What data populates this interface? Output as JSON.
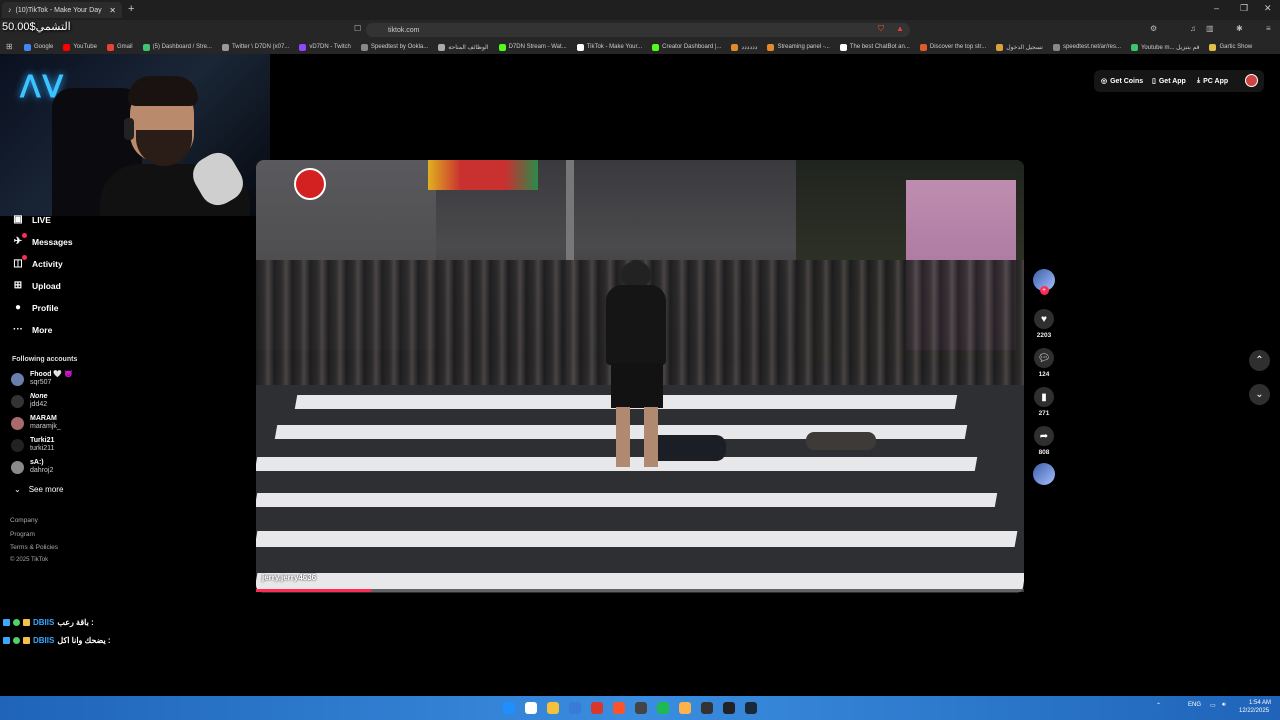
{
  "browser": {
    "tab_title": "(10)TikTok - Make Your Day",
    "tab_close": "✕",
    "new_tab": "+",
    "url": "tiktok.com",
    "window_controls": [
      "–",
      "❐",
      "✕"
    ],
    "bookmarks": [
      {
        "label": "Google",
        "color": "#4285f4"
      },
      {
        "label": "YouTube",
        "color": "#ff0000"
      },
      {
        "label": "Gmail",
        "color": "#ea4335"
      },
      {
        "label": "(5) Dashboard / Stre...",
        "color": "#3ec46d"
      },
      {
        "label": "Twitter \\ D7DN (x07...",
        "color": "#999999"
      },
      {
        "label": "vD7DN - Twitch",
        "color": "#9146ff"
      },
      {
        "label": "Speedtest by Ookla...",
        "color": "#888888"
      },
      {
        "label": "الوظائف المتاحة",
        "color": "#aaaaaa"
      },
      {
        "label": "D7DN Stream - Wat...",
        "color": "#53fc18"
      },
      {
        "label": "TikTok - Make Your...",
        "color": "#ffffff"
      },
      {
        "label": "Creator Dashboard |...",
        "color": "#53fc18"
      },
      {
        "label": "دددددد",
        "color": "#e08a2a"
      },
      {
        "label": "Streaming panel -...",
        "color": "#e08a2a"
      },
      {
        "label": "The best ChatBot an...",
        "color": "#ffffff"
      },
      {
        "label": "Discover the top str...",
        "color": "#e05a2a"
      },
      {
        "label": "تسجيل الدخول",
        "color": "#d9a23a"
      },
      {
        "label": "speedtest.net/ar/res...",
        "color": "#888888"
      },
      {
        "label": "Youtube m... قم بتنزيل",
        "color": "#3ec46d"
      },
      {
        "label": "Gartic Show",
        "color": "#e0c04a"
      }
    ]
  },
  "overlay": {
    "money": "50.00$التشمي",
    "chat": [
      {
        "user": "DBIIS",
        "message": "باقة رعب :"
      },
      {
        "user": "DBIIS",
        "message": "يضحك وانا اكل :"
      }
    ]
  },
  "sidebar": {
    "nav": [
      {
        "label": "LIVE",
        "icon": "▣",
        "badge": false
      },
      {
        "label": "Messages",
        "icon": "✈",
        "badge": true
      },
      {
        "label": "Activity",
        "icon": "◫",
        "badge": true
      },
      {
        "label": "Upload",
        "icon": "⊞",
        "badge": false
      },
      {
        "label": "Profile",
        "icon": "●",
        "badge": false
      },
      {
        "label": "More",
        "icon": "···",
        "badge": false
      }
    ],
    "following_title": "Following accounts",
    "accounts": [
      {
        "name": "Fhood 🤍 😈",
        "handle": "sqr507"
      },
      {
        "name": "None",
        "handle": "jdd42"
      },
      {
        "name": "MARAM",
        "handle": "maramjk_"
      },
      {
        "name": "Turki21",
        "handle": "turki211"
      },
      {
        "name": "sA:)",
        "handle": "dahroj2"
      }
    ],
    "see_more": "See more",
    "footer": [
      "Company",
      "Program",
      "Terms & Policies",
      "© 2025 TikTok"
    ]
  },
  "topbar": {
    "get_coins": "Get Coins",
    "get_app": "Get App",
    "pc_app": "PC App"
  },
  "video": {
    "username": "jerry.jerry4636",
    "progress": 0.15
  },
  "actions": {
    "likes": "2203",
    "comments": "124",
    "saves": "271",
    "shares": "808"
  },
  "taskbar": {
    "lang": "ENG",
    "time": "1:54 AM",
    "date": "12/22/2025"
  },
  "colors": {
    "accent": "#fe2c55",
    "taskbar": "#2a7ad0"
  }
}
